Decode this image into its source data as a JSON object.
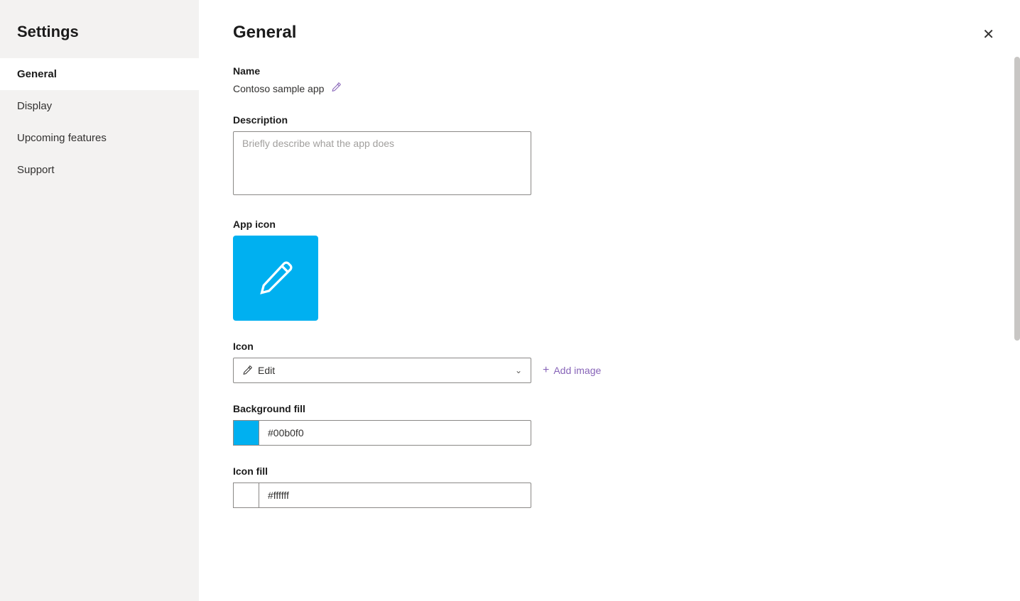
{
  "sidebar": {
    "title": "Settings",
    "items": [
      {
        "id": "general",
        "label": "General",
        "active": true
      },
      {
        "id": "display",
        "label": "Display",
        "active": false
      },
      {
        "id": "upcoming-features",
        "label": "Upcoming features",
        "active": false
      },
      {
        "id": "support",
        "label": "Support",
        "active": false
      }
    ]
  },
  "main": {
    "title": "General",
    "close_label": "✕",
    "sections": {
      "name": {
        "label": "Name",
        "value": "Contoso sample app"
      },
      "description": {
        "label": "Description",
        "placeholder": "Briefly describe what the app does"
      },
      "app_icon": {
        "label": "App icon",
        "background_color": "#00b0f0"
      },
      "icon": {
        "label": "Icon",
        "selected": "Edit",
        "add_image_label": "+ Add image"
      },
      "background_fill": {
        "label": "Background fill",
        "color": "#00b0f0",
        "value": "#00b0f0"
      },
      "icon_fill": {
        "label": "Icon fill",
        "color": "#ffffff",
        "value": "#ffffff"
      }
    }
  }
}
